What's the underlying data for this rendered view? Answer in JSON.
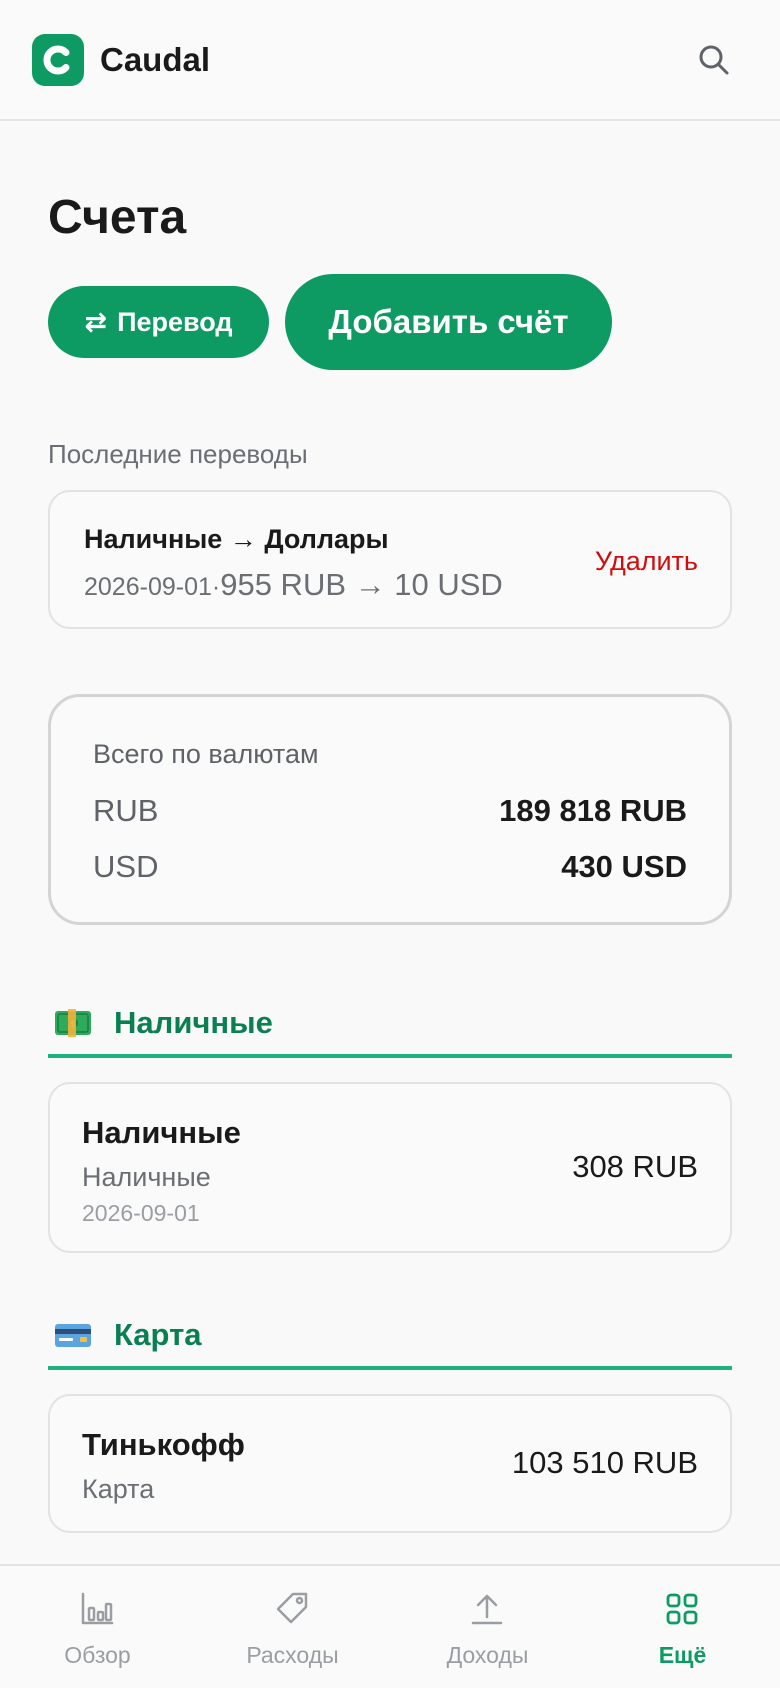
{
  "header": {
    "app_name": "Caudal"
  },
  "page": {
    "title": "Счета"
  },
  "actions": {
    "transfer_icon": "⇄",
    "transfer_label": "Перевод",
    "add_account_label": "Добавить счёт"
  },
  "recent_transfers": {
    "label": "Последние переводы",
    "items": [
      {
        "route": "Наличные → Доллары",
        "date": "2026-09-01",
        "separator": "·",
        "amount": "955 RUB → 10 USD",
        "delete_label": "Удалить"
      }
    ]
  },
  "totals": {
    "title": "Всего по валютам",
    "rows": [
      {
        "currency": "RUB",
        "value": "189 818 RUB"
      },
      {
        "currency": "USD",
        "value": "430 USD"
      }
    ]
  },
  "groups": [
    {
      "icon": "money-banknote-icon",
      "title": "Наличные",
      "accounts": [
        {
          "name": "Наличные",
          "type": "Наличные",
          "date": "2026-09-01",
          "balance": "308 RUB"
        }
      ]
    },
    {
      "icon": "credit-card-icon",
      "title": "Карта",
      "accounts": [
        {
          "name": "Тинькофф",
          "type": "Карта",
          "balance": "103 510 RUB"
        }
      ]
    }
  ],
  "tabbar": {
    "items": [
      {
        "label": "Обзор",
        "icon": "bar-chart-icon",
        "active": false
      },
      {
        "label": "Расходы",
        "icon": "tag-icon",
        "active": false
      },
      {
        "label": "Доходы",
        "icon": "upload-icon",
        "active": false
      },
      {
        "label": "Ещё",
        "icon": "grid-icon",
        "active": true
      }
    ]
  },
  "colors": {
    "brand": "#0e9a63",
    "group_title": "#0a7f52",
    "group_underline": "#1eb283",
    "danger": "#d10c0c"
  }
}
